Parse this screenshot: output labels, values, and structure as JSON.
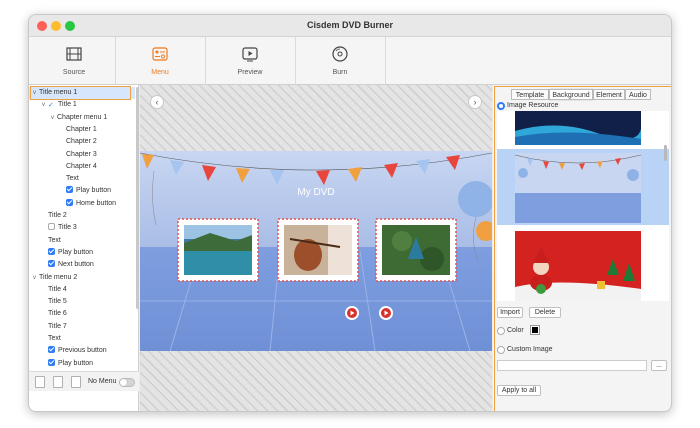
{
  "window": {
    "title": "Cisdem DVD Burner",
    "traffic_lights": {
      "close": "#fe5f57",
      "minimize": "#febc2e",
      "zoom": "#28c840"
    }
  },
  "toolbar": {
    "items": [
      {
        "label": "Source",
        "icon": "film-icon",
        "active": false
      },
      {
        "label": "Menu",
        "icon": "menu-icon",
        "active": true
      },
      {
        "label": "Preview",
        "icon": "play-icon",
        "active": false
      },
      {
        "label": "Burn",
        "icon": "disc-icon",
        "active": false
      }
    ],
    "accent": "#f07a1a"
  },
  "tree": {
    "rows": [
      {
        "label": "Title menu 1",
        "indent": 0,
        "caret": "v",
        "checkbox": "none",
        "selected": true
      },
      {
        "label": "Title 1",
        "indent": 1,
        "caret": "v",
        "checkbox": "check"
      },
      {
        "label": "Chapter menu 1",
        "indent": 2,
        "caret": "v",
        "checkbox": "none"
      },
      {
        "label": "Chapter 1",
        "indent": 3,
        "caret": "",
        "checkbox": "none"
      },
      {
        "label": "Chapter 2",
        "indent": 3,
        "caret": "",
        "checkbox": "none"
      },
      {
        "label": "Chapter 3",
        "indent": 3,
        "caret": "",
        "checkbox": "none"
      },
      {
        "label": "Chapter 4",
        "indent": 3,
        "caret": "",
        "checkbox": "none"
      },
      {
        "label": "Text",
        "indent": 3,
        "caret": "",
        "checkbox": "none"
      },
      {
        "label": "Play button",
        "indent": 3,
        "caret": "",
        "checkbox": "on"
      },
      {
        "label": "Home button",
        "indent": 3,
        "caret": "",
        "checkbox": "on"
      },
      {
        "label": "Title 2",
        "indent": 1,
        "caret": "",
        "checkbox": "none"
      },
      {
        "label": "Title 3",
        "indent": 1,
        "caret": "",
        "checkbox": "off"
      },
      {
        "label": "Text",
        "indent": 1,
        "caret": "",
        "checkbox": "none"
      },
      {
        "label": "Play button",
        "indent": 1,
        "caret": "",
        "checkbox": "on"
      },
      {
        "label": "Next button",
        "indent": 1,
        "caret": "",
        "checkbox": "on"
      },
      {
        "label": "Title menu 2",
        "indent": 0,
        "caret": "v",
        "checkbox": "none"
      },
      {
        "label": "Title 4",
        "indent": 1,
        "caret": "",
        "checkbox": "none"
      },
      {
        "label": "Title 5",
        "indent": 1,
        "caret": "",
        "checkbox": "none"
      },
      {
        "label": "Title 6",
        "indent": 1,
        "caret": "",
        "checkbox": "none"
      },
      {
        "label": "Title 7",
        "indent": 1,
        "caret": "",
        "checkbox": "none"
      },
      {
        "label": "Text",
        "indent": 1,
        "caret": "",
        "checkbox": "none"
      },
      {
        "label": "Previous button",
        "indent": 1,
        "caret": "",
        "checkbox": "on"
      },
      {
        "label": "Play button",
        "indent": 1,
        "caret": "",
        "checkbox": "on"
      }
    ],
    "no_menu_label": "No Menu"
  },
  "canvas": {
    "menu_title": "My DVD",
    "nav_prev": "‹",
    "nav_next": "›",
    "thumbnails": [
      "river-landscape",
      "violin-player",
      "forest-aerial"
    ]
  },
  "right_panel": {
    "tabs": [
      {
        "label": "Template",
        "active": false
      },
      {
        "label": "Background",
        "active": true
      },
      {
        "label": "Element",
        "active": false
      },
      {
        "label": "Audio",
        "active": false
      }
    ],
    "image_resource_label": "Image Resource",
    "import_label": "Import",
    "delete_label": "Delete",
    "color_label": "Color",
    "custom_image_label": "Custom Image",
    "browse_label": "...",
    "apply_all_label": "Apply to all"
  }
}
